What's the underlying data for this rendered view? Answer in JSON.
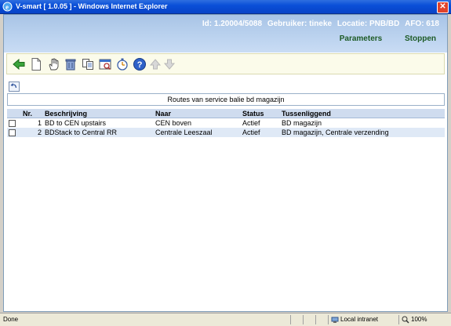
{
  "window": {
    "title": "V-smart [ 1.0.05 ] - Windows Internet Explorer",
    "close_symbol": "✕"
  },
  "header": {
    "id_text": "Id: 1.20004/5088",
    "user_text": "Gebruiker: tineke",
    "location_text": "Locatie: PNB/BD",
    "afo_text": "AFO: 618",
    "links": {
      "parameters": "Parameters",
      "stoppen": "Stoppen"
    }
  },
  "toolbar": {
    "icons": [
      "back-arrow-icon",
      "new-document-icon",
      "hand-select-icon",
      "trash-icon",
      "copy-icon",
      "details-icon",
      "stopwatch-icon",
      "help-icon",
      "arrow-up-icon",
      "arrow-down-icon"
    ]
  },
  "caption": "Routes van service balie bd magazijn",
  "table": {
    "headers": {
      "nr": "Nr.",
      "beschrijving": "Beschrijving",
      "naar": "Naar",
      "status": "Status",
      "tussenliggend": "Tussenliggend"
    },
    "rows": [
      {
        "nr": "1",
        "beschrijving": "BD to CEN upstairs",
        "naar": "CEN boven",
        "status": "Actief",
        "tussenliggend": "BD magazijn"
      },
      {
        "nr": "2",
        "beschrijving": "BDStack to Central RR",
        "naar": "Centrale Leeszaal",
        "status": "Actief",
        "tussenliggend": "BD magazijn, Centrale verzending"
      }
    ]
  },
  "statusbar": {
    "left": "Done",
    "zone": "Local intranet",
    "zoom": "100%"
  },
  "colors": {
    "title_bar": "#0a4fd8",
    "header_bg": "#bcd3ef",
    "link_green": "#1d5a25",
    "toolbar_bg": "#fbfbea",
    "row_alt": "#dfe9f6",
    "table_header": "#cfdcef"
  }
}
